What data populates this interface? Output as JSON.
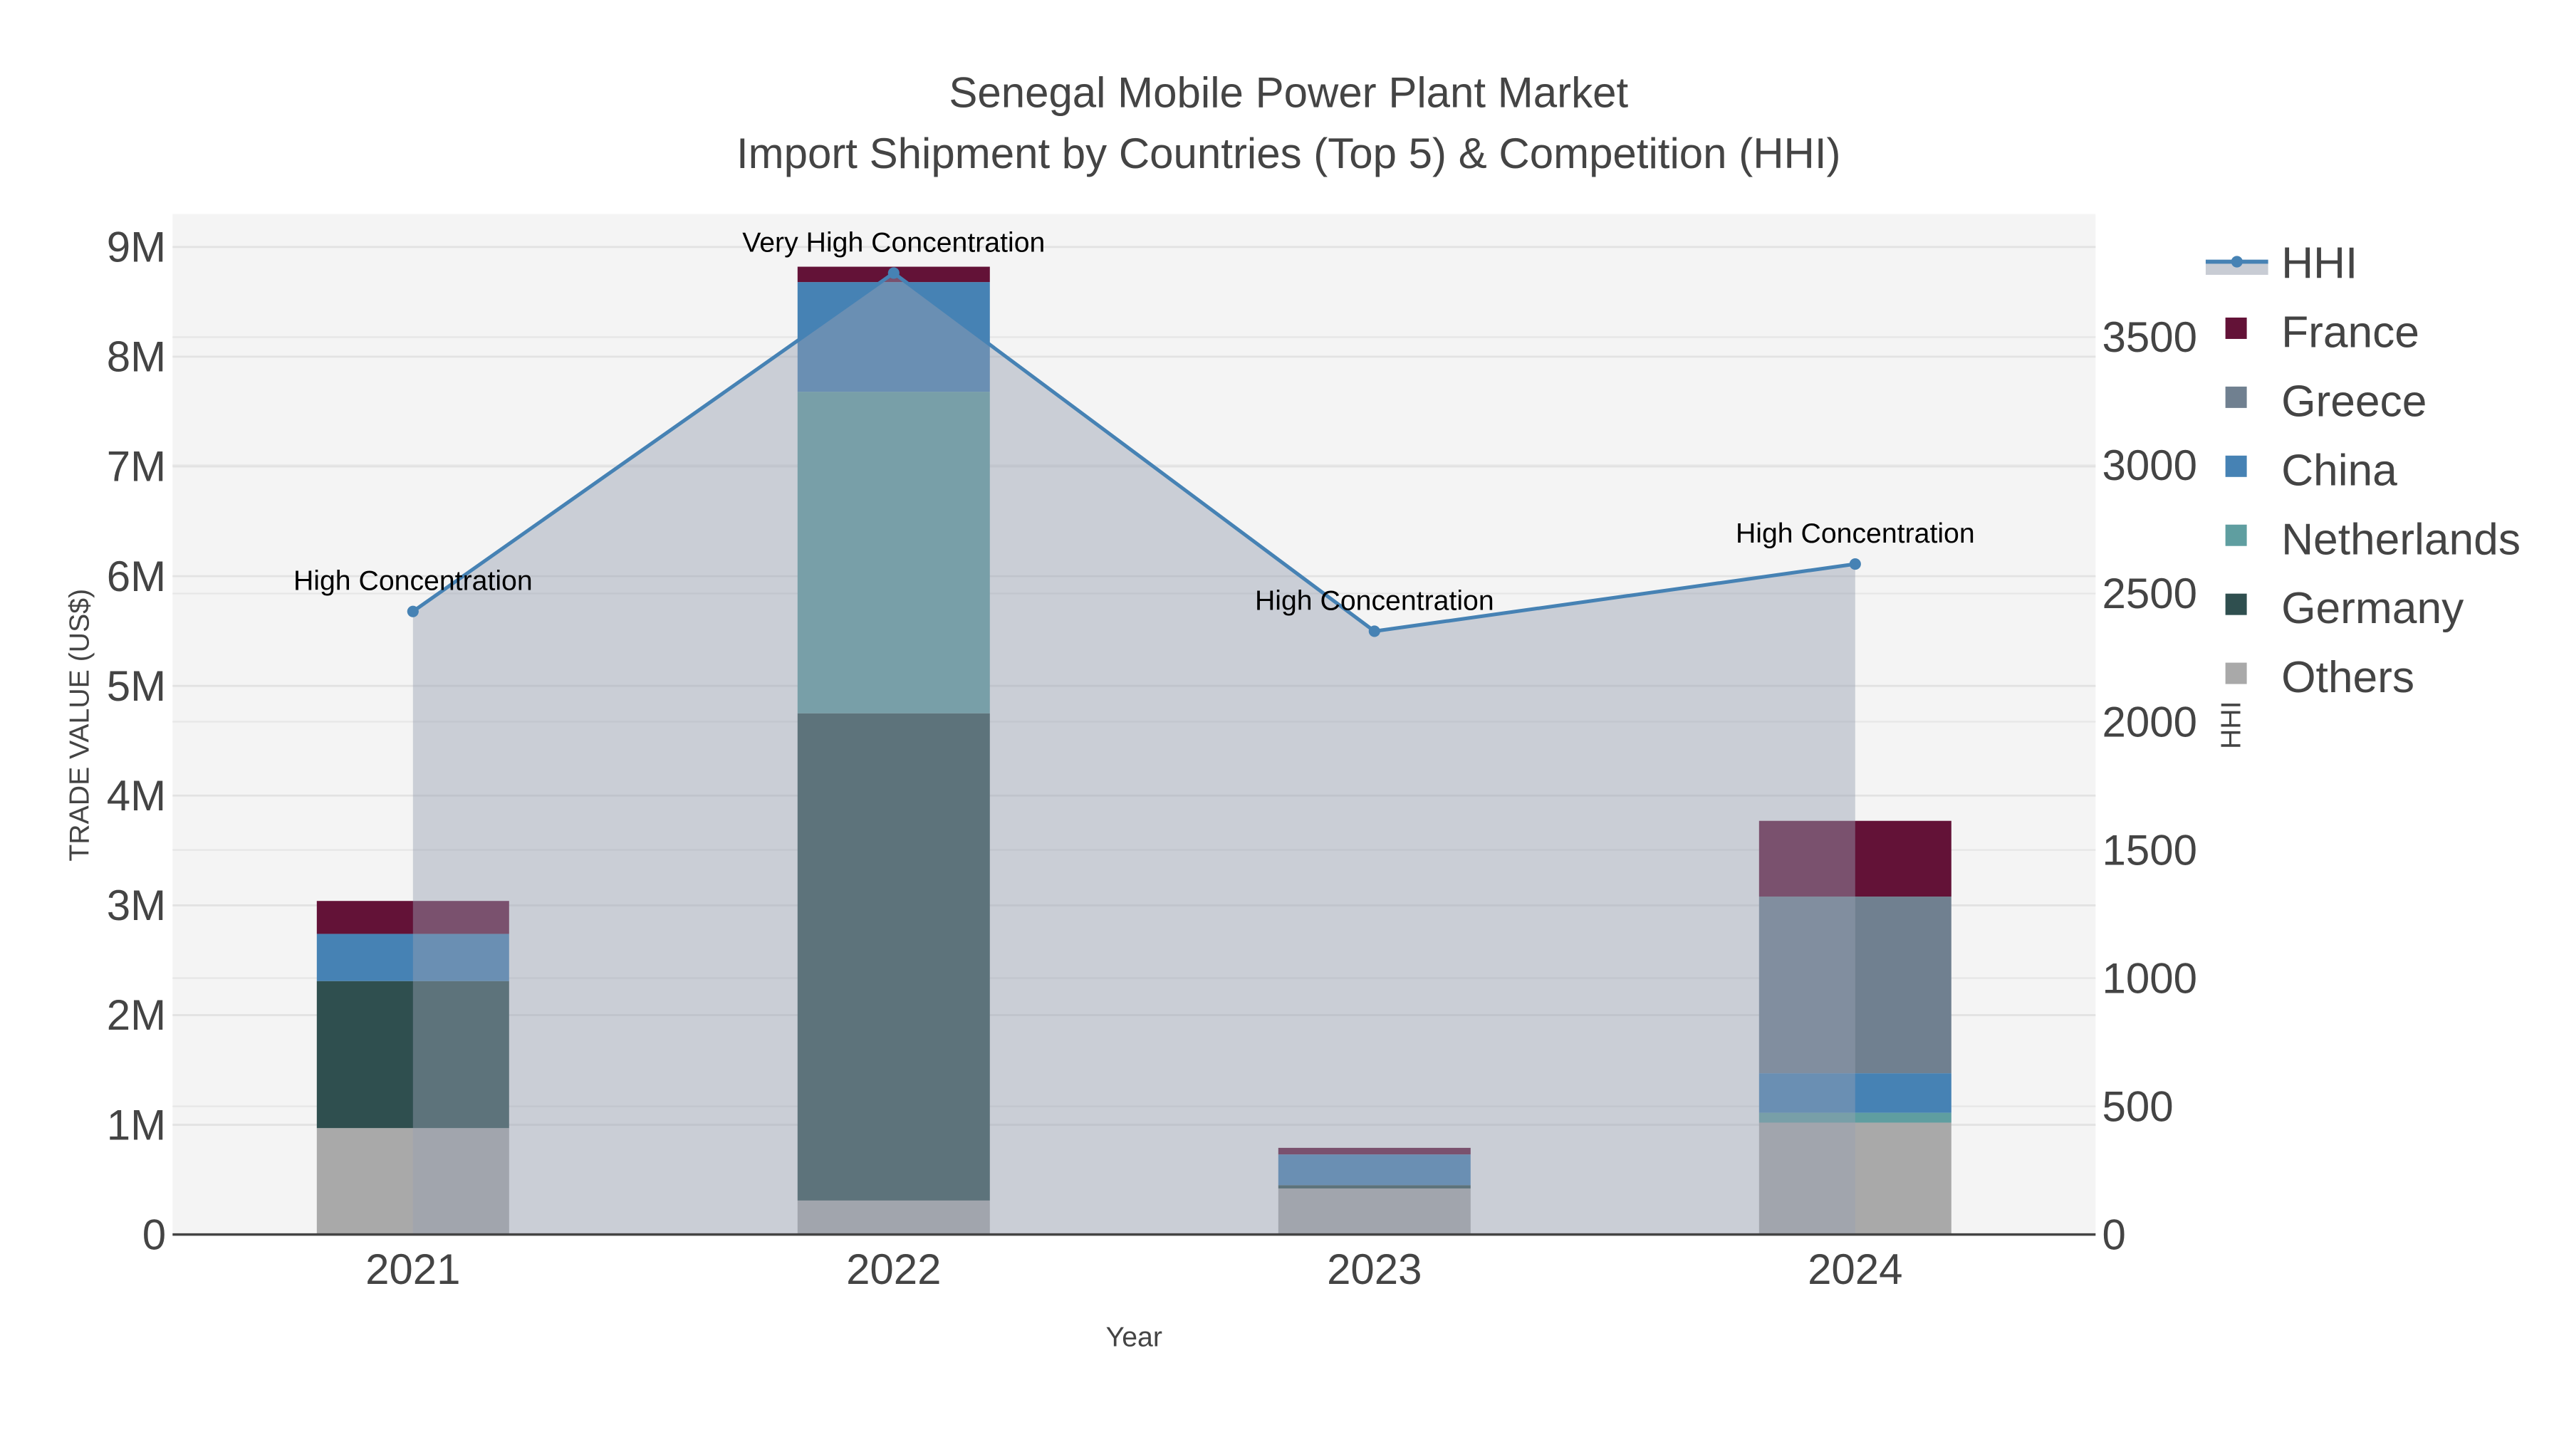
{
  "chart_data": {
    "type": "bar",
    "title": "Senegal Mobile Power Plant Market",
    "subtitle": "Import Shipment by Countries (Top 5) & Competition (HHI)",
    "xlabel": "Year",
    "ylabel": "TRADE VALUE (US$)",
    "y2label": "HHI",
    "categories": [
      "2021",
      "2022",
      "2023",
      "2024"
    ],
    "ylim": [
      0,
      9.3
    ],
    "y2lim": [
      0,
      3980
    ],
    "yticks": [
      0,
      1,
      2,
      3,
      4,
      5,
      6,
      7,
      8,
      9
    ],
    "ytick_labels": [
      "0",
      "1M",
      "2M",
      "3M",
      "4M",
      "5M",
      "6M",
      "7M",
      "8M",
      "9M"
    ],
    "y2ticks": [
      0,
      500,
      1000,
      1500,
      2000,
      2500,
      3000,
      3500
    ],
    "y2tick_labels": [
      "0",
      "500",
      "1000",
      "1500",
      "2000",
      "2500",
      "3000",
      "3500"
    ],
    "value_unit": "millions US$",
    "stacked": true,
    "series": [
      {
        "name": "Others",
        "color": "#a9a9a9",
        "values": [
          0.97,
          0.31,
          0.42,
          1.02
        ]
      },
      {
        "name": "Germany",
        "color": "#2f4f4f",
        "values": [
          1.34,
          4.44,
          0.03,
          0
        ]
      },
      {
        "name": "Netherlands",
        "color": "#5f9ea0",
        "values": [
          0,
          2.93,
          0,
          0.09
        ]
      },
      {
        "name": "China",
        "color": "#4682b4",
        "values": [
          0.43,
          1.0,
          0.28,
          0.36
        ]
      },
      {
        "name": "Greece",
        "color": "#708090",
        "values": [
          0,
          0,
          0,
          1.61
        ]
      },
      {
        "name": "France",
        "color": "#631237",
        "values": [
          0.3,
          0.14,
          0.06,
          0.69
        ]
      }
    ],
    "hhi": {
      "name": "HHI",
      "color": "#4682b4",
      "values": [
        2430,
        3750,
        2353,
        2615
      ],
      "annotations": [
        "High Concentration",
        "Very High Concentration",
        "High Concentration",
        "High Concentration"
      ]
    },
    "legend_order": [
      "HHI",
      "France",
      "Greece",
      "China",
      "Netherlands",
      "Germany",
      "Others"
    ],
    "legend_position": "right",
    "grid": true
  }
}
